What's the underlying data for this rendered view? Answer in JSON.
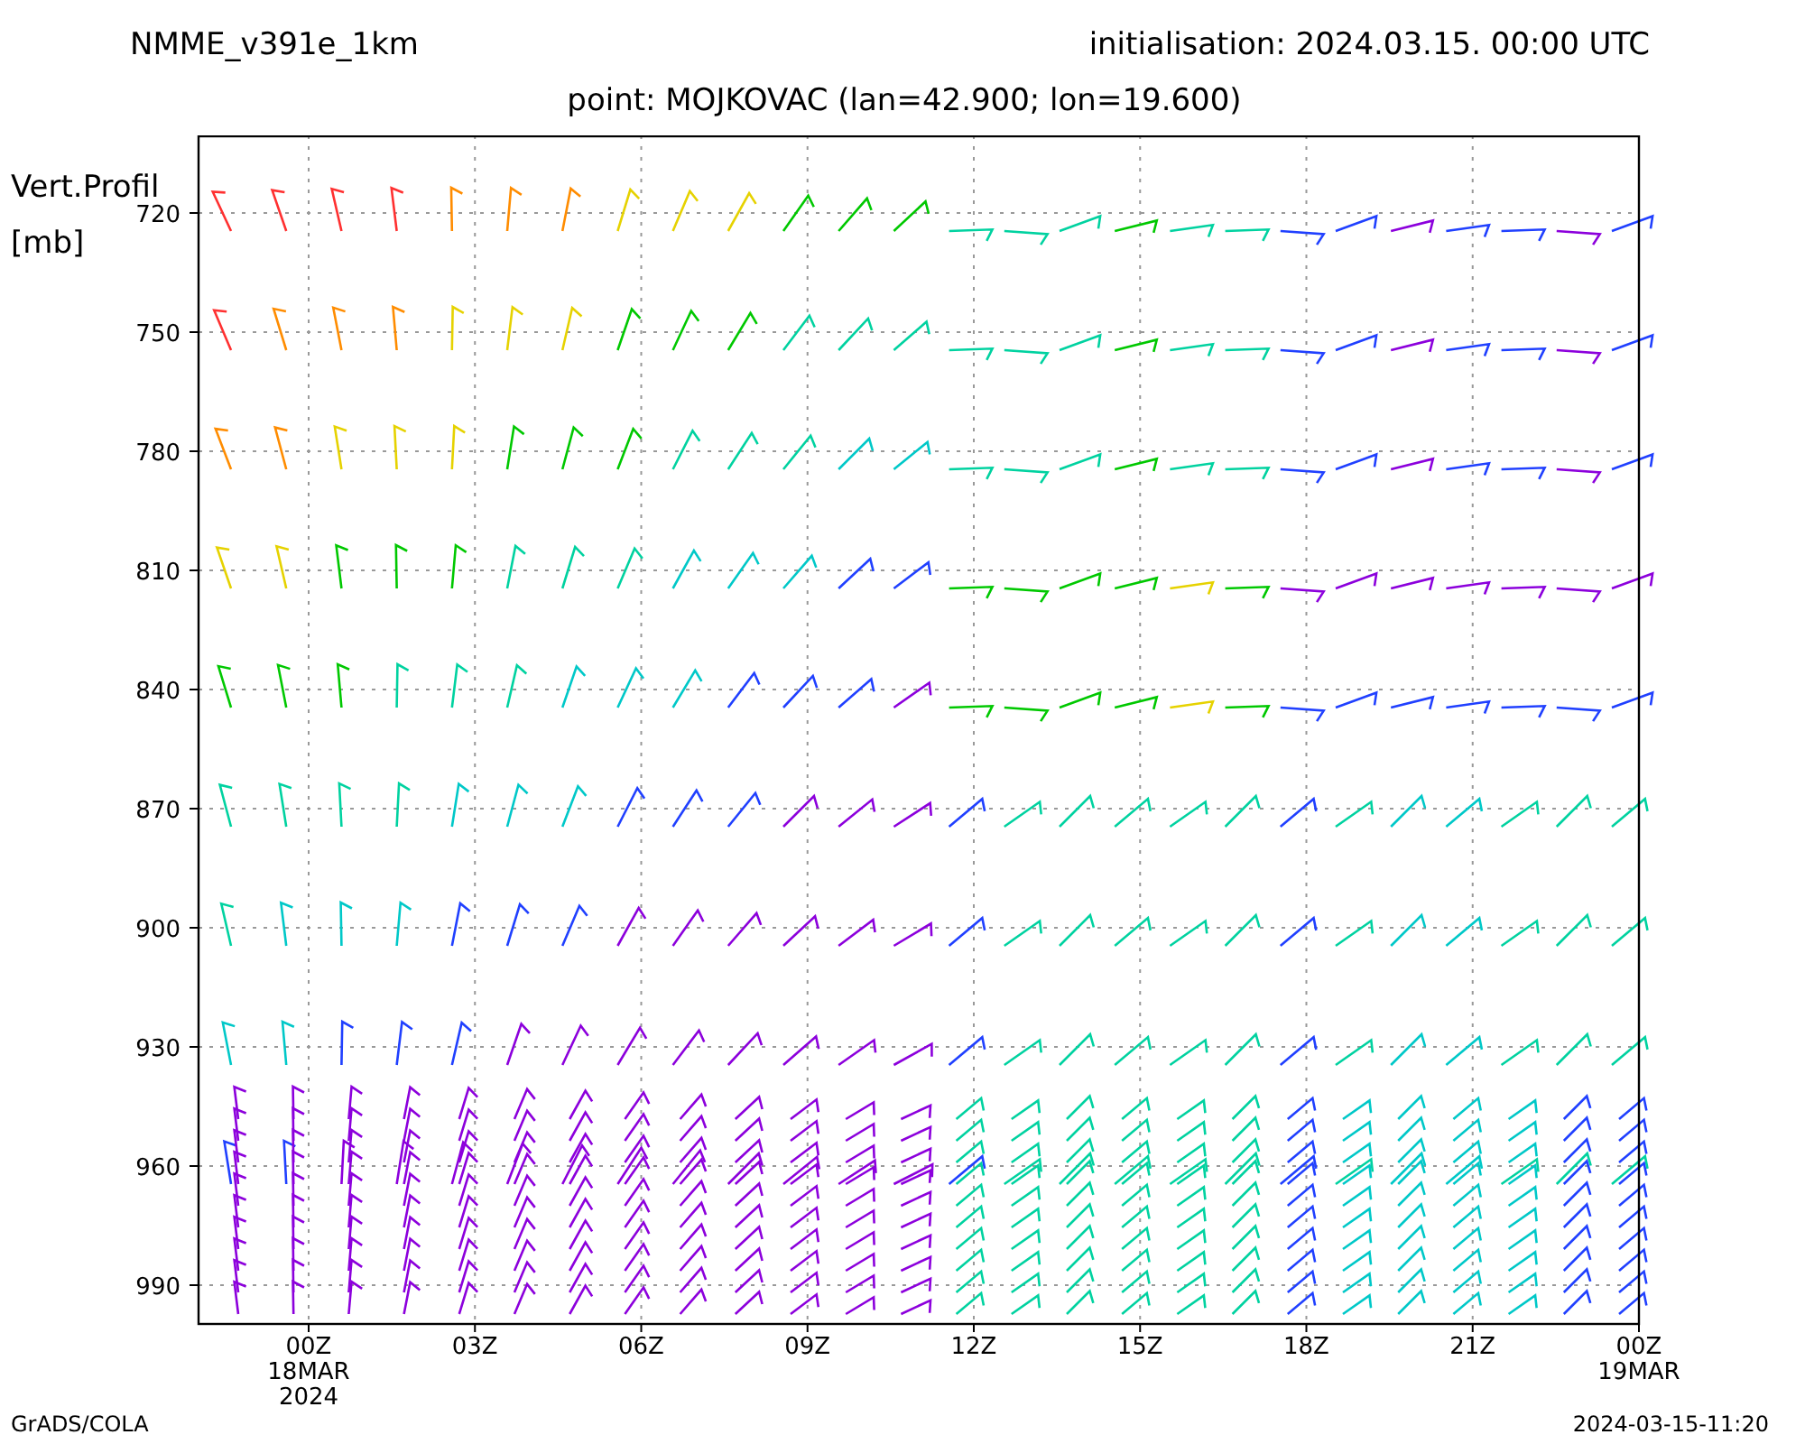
{
  "header": {
    "model": "NMME_v391e_1km",
    "initialisation": "initialisation: 2024.03.15. 00:00 UTC"
  },
  "title": "point: MOJKOVAC (lan=42.900; lon=19.600)",
  "y_axis": {
    "label_lines": [
      "Vert.Profil",
      "[mb]"
    ],
    "ticks": [
      "720",
      "750",
      "780",
      "810",
      "840",
      "870",
      "900",
      "930",
      "960",
      "990"
    ]
  },
  "x_axis": {
    "ticks": [
      {
        "label": "00Z",
        "date_lines": [
          "18MAR",
          "2024"
        ]
      },
      {
        "label": "03Z"
      },
      {
        "label": "06Z"
      },
      {
        "label": "09Z"
      },
      {
        "label": "12Z"
      },
      {
        "label": "15Z"
      },
      {
        "label": "18Z"
      },
      {
        "label": "21Z"
      },
      {
        "label": "00Z",
        "date_lines": [
          "19MAR"
        ]
      }
    ]
  },
  "footer": {
    "left": "GrADS/COLA",
    "right": "2024-03-15-11:20"
  }
}
